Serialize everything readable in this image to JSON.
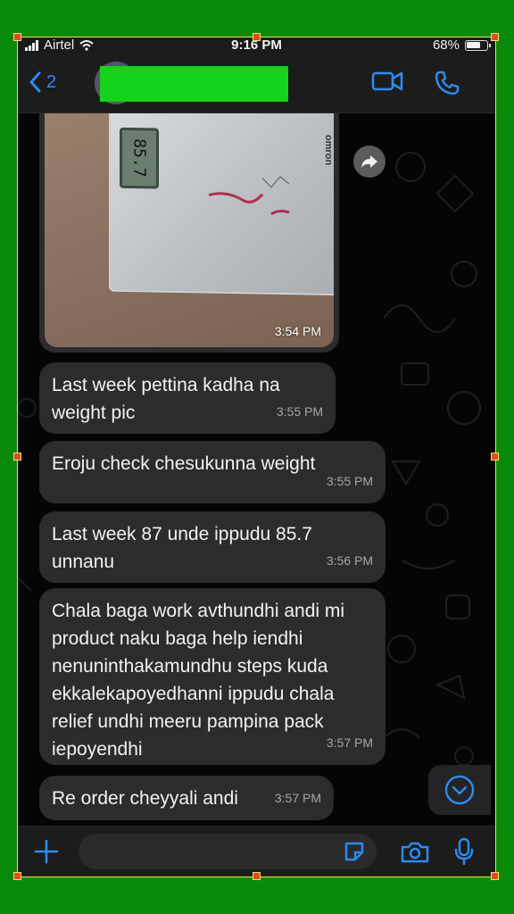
{
  "status_bar": {
    "carrier": "Airtel",
    "time": "9:16 PM",
    "battery": "68%"
  },
  "header": {
    "back_count": "2"
  },
  "messages": [
    {
      "text": "Last week pettina kadha na weight pic",
      "time": "3:55 PM"
    },
    {
      "text": "Eroju check chesukunna weight",
      "time": "3:55 PM"
    },
    {
      "text": "Last week 87 unde ippudu 85.7 unnanu",
      "time": "3:56 PM"
    },
    {
      "text": "Chala baga work avthundhi andi mi product naku baga help iendhi nenuninthakamundhu steps kuda ekkalekapoyedhanni ippudu chala relief undhi meeru pampina pack iepoyendhi",
      "time": "3:57 PM"
    },
    {
      "text": "Re order cheyyali andi",
      "time": "3:57 PM"
    }
  ],
  "photo_message": {
    "time": "3:54 PM",
    "scale_display": "85.7",
    "scale_brand": "omron"
  },
  "icons": {
    "back": "chevron-left-icon",
    "video": "video-camera-icon",
    "call": "phone-icon",
    "forward": "forward-arrow-icon",
    "scroll": "chevron-down-circle-icon",
    "plus": "plus-icon",
    "sticker": "sticker-icon",
    "camera": "camera-icon",
    "mic": "microphone-icon"
  },
  "colors": {
    "accent": "#2d8cf0",
    "bubble": "#2c2c2e",
    "redaction": "#15d21a",
    "frame_green": "#0a8a0a"
  }
}
